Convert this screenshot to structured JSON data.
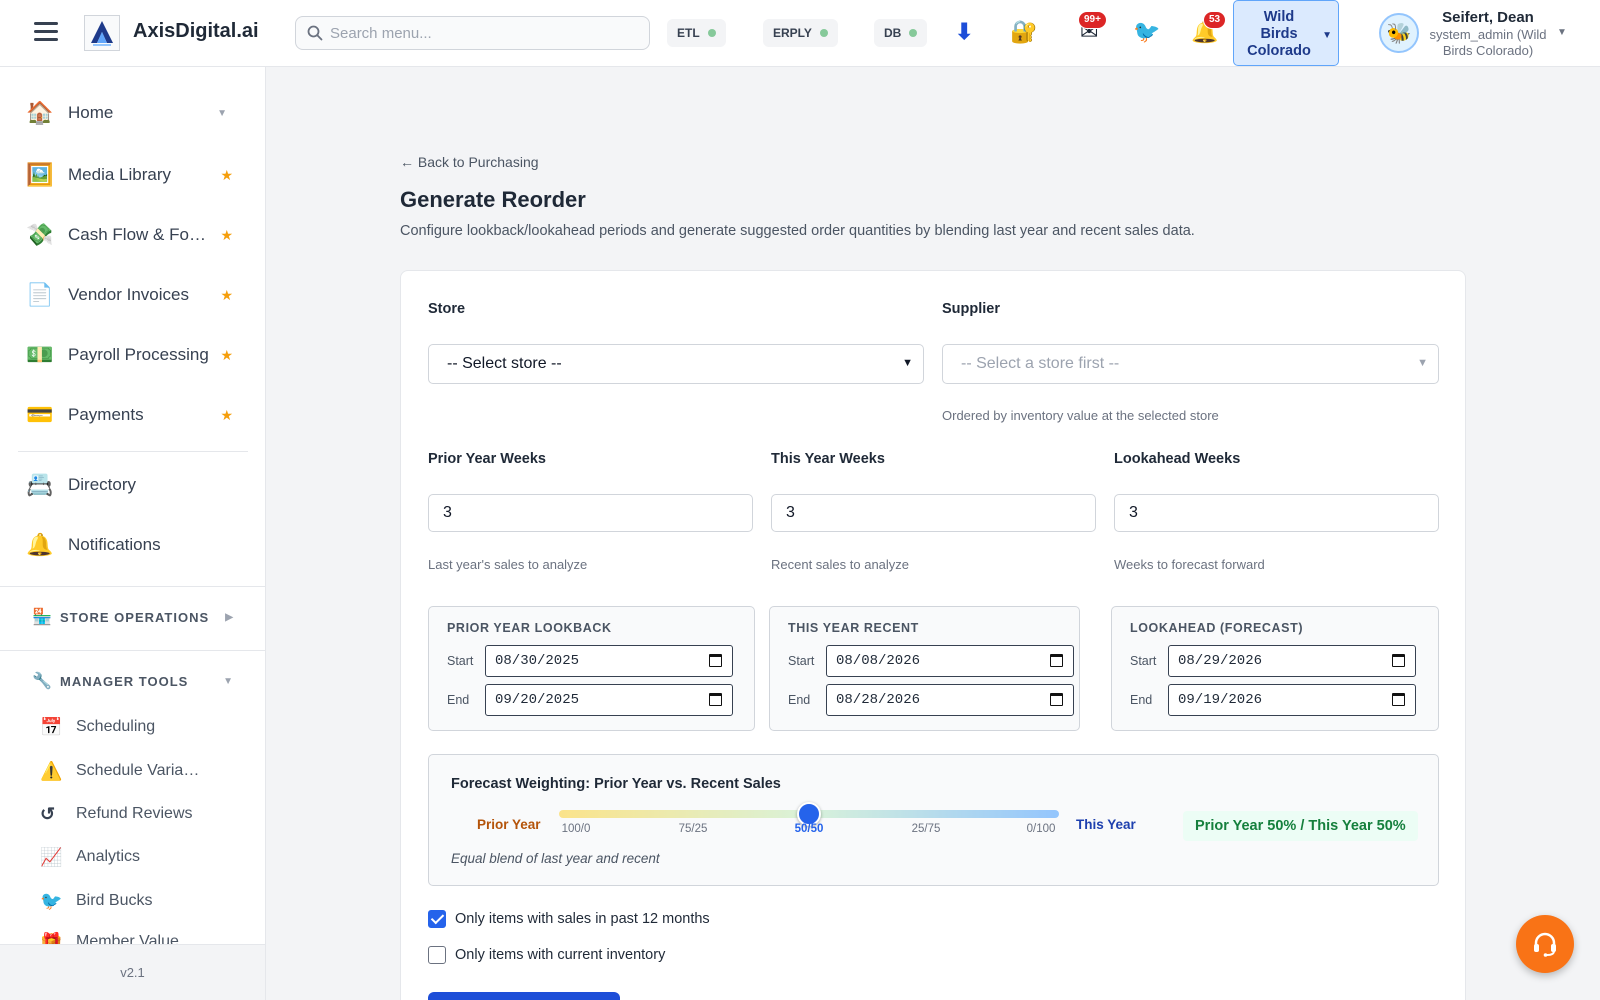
{
  "header": {
    "brand": "AxisDigital.ai",
    "logo_text": "axisdigital.ai",
    "search_placeholder": "Search menu...",
    "status_pills": [
      {
        "label": "ETL",
        "status_color": "#86c99a"
      },
      {
        "label": "ERPLY",
        "status_color": "#86c99a"
      },
      {
        "label": "DB",
        "status_color": "#86c99a"
      }
    ],
    "icons": {
      "download": "download-icon",
      "lock": "lock-icon",
      "mail": "mail-icon",
      "bird": "bird-icon",
      "bell": "bell-icon"
    },
    "mail_badge": "99+",
    "bell_badge": "53",
    "store_switcher": {
      "line1": "Wild",
      "line2": "Birds",
      "line3": "Colorado"
    },
    "user": {
      "name": "Seifert, Dean",
      "role": "system_admin (Wild Birds Colorado)"
    }
  },
  "sidebar": {
    "items": [
      {
        "icon": "🏠",
        "label": "Home",
        "right": "▼"
      },
      {
        "icon": "🖼️",
        "label": "Media Library",
        "right": "★"
      },
      {
        "icon": "💸",
        "label": "Cash Flow & Forecasting",
        "right": "★"
      },
      {
        "icon": "📄",
        "label": "Vendor Invoices",
        "right": "★"
      },
      {
        "icon": "💵",
        "label": "Payroll Processing",
        "right": "★"
      },
      {
        "icon": "💳",
        "label": "Payments",
        "right": "★"
      },
      {
        "icon": "📇",
        "label": "Directory",
        "right": ""
      },
      {
        "icon": "🔔",
        "label": "Notifications",
        "right": ""
      }
    ],
    "sections": [
      {
        "icon": "🏪",
        "label": "STORE OPERATIONS",
        "caret": "▶"
      },
      {
        "icon": "🔧",
        "label": "MANAGER TOOLS",
        "caret": "▼"
      }
    ],
    "sub_items": [
      {
        "icon": "📅",
        "label": "Scheduling"
      },
      {
        "icon": "⚠️",
        "label": "Schedule Variance"
      },
      {
        "icon": "↺",
        "label": "Refund Reviews"
      },
      {
        "icon": "📈",
        "label": "Analytics"
      },
      {
        "icon": "🐦",
        "label": "Bird Bucks"
      },
      {
        "icon": "🎁",
        "label": "Member Value"
      }
    ],
    "version": "v2.1"
  },
  "main": {
    "back_link": "← Back to Purchasing",
    "title": "Generate Reorder",
    "description": "Configure lookback/lookahead periods and generate suggested order quantities by blending last year and recent sales data.",
    "store": {
      "label": "Store",
      "value": "-- Select store --"
    },
    "supplier": {
      "label": "Supplier",
      "value": "-- Select a store first --",
      "help": "Ordered by inventory value at the selected store"
    },
    "weeks": [
      {
        "label": "Prior Year Weeks",
        "value": "3",
        "help": "Last year's sales to analyze"
      },
      {
        "label": "This Year Weeks",
        "value": "3",
        "help": "Recent sales to analyze"
      },
      {
        "label": "Lookahead Weeks",
        "value": "3",
        "help": "Weeks to forecast forward"
      }
    ],
    "ranges": [
      {
        "title": "PRIOR YEAR LOOKBACK",
        "start_label": "Start",
        "start": "08/30/2025",
        "end_label": "End",
        "end": "09/20/2025"
      },
      {
        "title": "THIS YEAR RECENT",
        "start_label": "Start",
        "start": "08/08/2026",
        "end_label": "End",
        "end": "08/28/2026"
      },
      {
        "title": "LOOKAHEAD (FORECAST)",
        "start_label": "Start",
        "start": "08/29/2026",
        "end_label": "End",
        "end": "09/19/2026"
      }
    ],
    "weighting": {
      "title": "Forecast Weighting: Prior Year vs. Recent Sales",
      "left_label": "Prior Year",
      "right_label": "This Year",
      "ticks": [
        "100/0",
        "75/25",
        "50/50",
        "25/75",
        "0/100"
      ],
      "value_this_year_percent": 50,
      "summary": "Prior Year 50% / This Year 50%",
      "note": "Equal blend of last year and recent"
    },
    "checkboxes": [
      {
        "label": "Only items with sales in past 12 months",
        "checked": true
      },
      {
        "label": "Only items with current inventory",
        "checked": false
      }
    ]
  },
  "colors": {
    "accent": "#2563eb",
    "fab": "#f97316",
    "badge": "#dc2626"
  }
}
